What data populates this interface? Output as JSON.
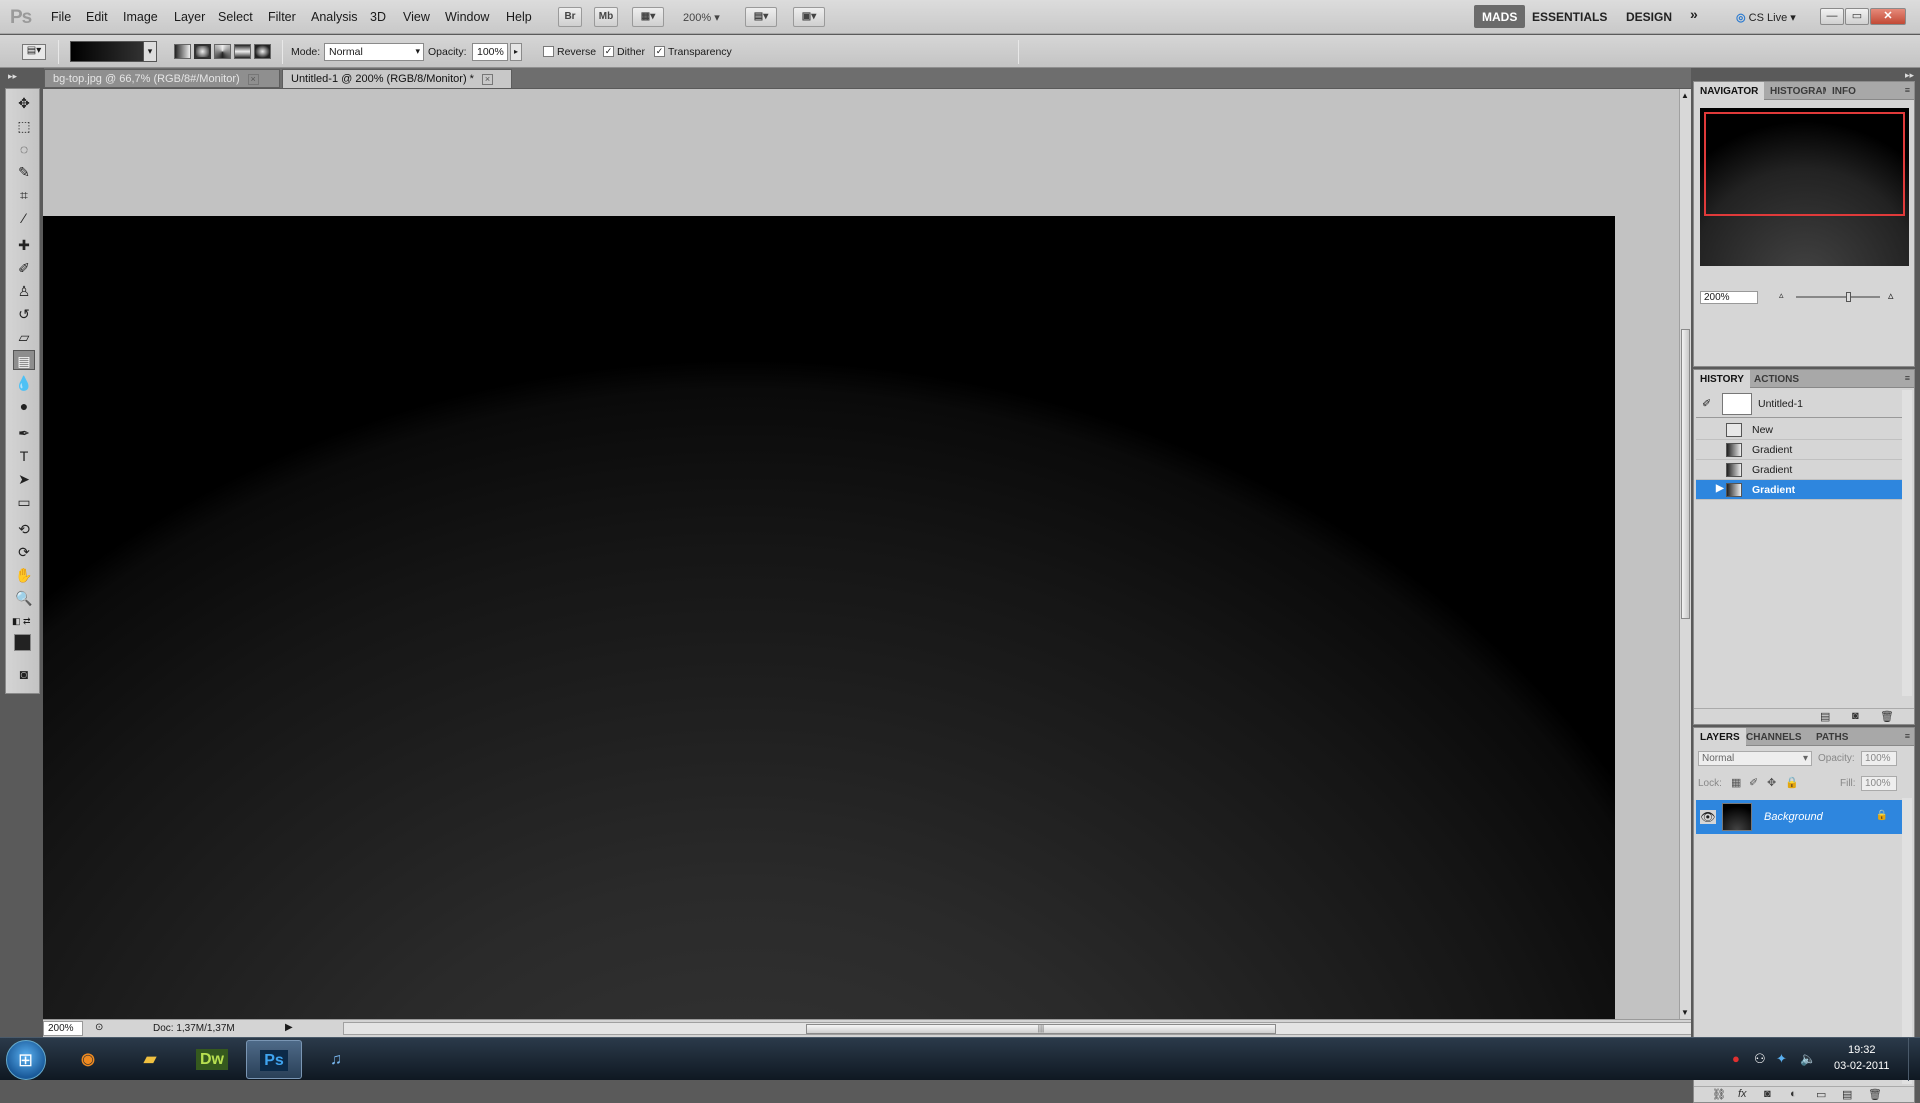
{
  "app": {
    "logo": "Ps"
  },
  "menu": [
    "File",
    "Edit",
    "Image",
    "Layer",
    "Select",
    "Filter",
    "Analysis",
    "3D",
    "View",
    "Window",
    "Help"
  ],
  "appbar": {
    "bridge": "Br",
    "minibridge": "Mb",
    "zoom": "200%"
  },
  "workspaces": {
    "active": "MADS",
    "items": [
      "ESSENTIALS",
      "DESIGN"
    ],
    "more": "»",
    "cslive": "CS Live"
  },
  "window_buttons": {
    "minimize": "—",
    "restore": "▭",
    "close": "✕"
  },
  "options": {
    "mode_label": "Mode:",
    "mode_value": "Normal",
    "opacity_label": "Opacity:",
    "opacity_value": "100%",
    "reverse_label": "Reverse",
    "reverse_checked": false,
    "dither_label": "Dither",
    "dither_checked": true,
    "transparency_label": "Transparency",
    "transparency_checked": true
  },
  "tabs": [
    {
      "label": "bg-top.jpg @ 66,7% (RGB/8#/Monitor)",
      "active": false
    },
    {
      "label": "Untitled-1 @ 200% (RGB/8/Monitor) *",
      "active": true
    }
  ],
  "status": {
    "zoom": "200%",
    "doc": "Doc: 1,37M/1,37M"
  },
  "navigator": {
    "tabs": [
      "NAVIGATOR",
      "HISTOGRAM",
      "INFO"
    ],
    "zoom": "200%"
  },
  "history": {
    "tabs": [
      "HISTORY",
      "ACTIONS"
    ],
    "snapshot": "Untitled-1",
    "items": [
      {
        "label": "New",
        "selected": false
      },
      {
        "label": "Gradient",
        "selected": false
      },
      {
        "label": "Gradient",
        "selected": false
      },
      {
        "label": "Gradient",
        "selected": true
      }
    ]
  },
  "layers": {
    "tabs": [
      "LAYERS",
      "CHANNELS",
      "PATHS"
    ],
    "blend_mode": "Normal",
    "opacity_label": "Opacity:",
    "opacity_value": "100%",
    "lock_label": "Lock:",
    "fill_label": "Fill:",
    "fill_value": "100%",
    "items": [
      {
        "label": "Background",
        "selected": true,
        "locked": true
      }
    ]
  },
  "taskbar": {
    "apps": [
      "Firefox",
      "Explorer",
      "Dw",
      "Ps",
      "iTunes"
    ],
    "active_app": "Ps",
    "time": "19:32",
    "date": "03-02-2011"
  },
  "colors": {
    "selection": "#2e86de",
    "nav_box": "#e03a3a",
    "workspace_active": "#6b6b6b"
  }
}
